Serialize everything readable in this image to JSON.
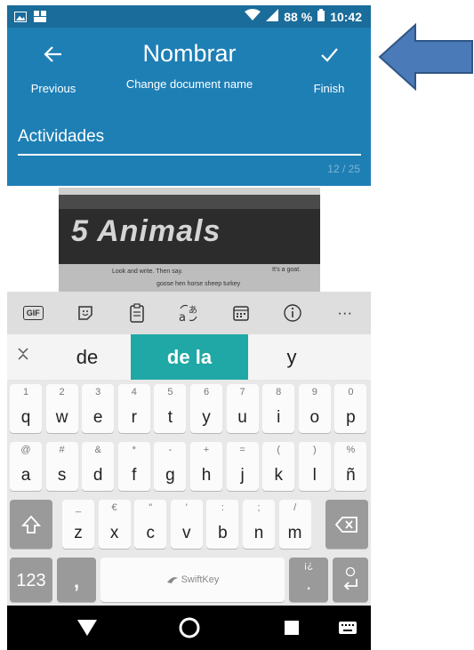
{
  "status_bar": {
    "battery": "88 %",
    "time": "10:42"
  },
  "app_bar": {
    "previous_label": "Previous",
    "title": "Nombrar",
    "subtitle": "Change document name",
    "finish_label": "Finish",
    "name_value": "Actividades",
    "char_count": "12 / 25"
  },
  "preview": {
    "heading": "5 Animals",
    "instruction": "Look and write. Then say.",
    "badge": "It's a goat.",
    "words": "goose  hen  horse  sheep  turkey"
  },
  "keyboard": {
    "toolbar": {
      "gif": "GIF",
      "more": "···"
    },
    "suggestions": [
      "de",
      "de la",
      "y"
    ],
    "row1": [
      {
        "hint": "1",
        "key": "q"
      },
      {
        "hint": "2",
        "key": "w"
      },
      {
        "hint": "3",
        "key": "e"
      },
      {
        "hint": "4",
        "key": "r"
      },
      {
        "hint": "5",
        "key": "t"
      },
      {
        "hint": "6",
        "key": "y"
      },
      {
        "hint": "7",
        "key": "u"
      },
      {
        "hint": "8",
        "key": "i"
      },
      {
        "hint": "9",
        "key": "o"
      },
      {
        "hint": "0",
        "key": "p"
      }
    ],
    "row2": [
      {
        "hint": "@",
        "key": "a"
      },
      {
        "hint": "#",
        "key": "s"
      },
      {
        "hint": "&",
        "key": "d"
      },
      {
        "hint": "*",
        "key": "f"
      },
      {
        "hint": "-",
        "key": "g"
      },
      {
        "hint": "+",
        "key": "h"
      },
      {
        "hint": "=",
        "key": "j"
      },
      {
        "hint": "(",
        "key": "k"
      },
      {
        "hint": ")",
        "key": "l"
      },
      {
        "hint": "%",
        "key": "ñ"
      }
    ],
    "row3": [
      {
        "hint": "_",
        "key": "z"
      },
      {
        "hint": "€",
        "key": "x"
      },
      {
        "hint": "\"",
        "key": "c"
      },
      {
        "hint": "'",
        "key": "v"
      },
      {
        "hint": ":",
        "key": "b"
      },
      {
        "hint": ";",
        "key": "n"
      },
      {
        "hint": "/",
        "key": "m"
      }
    ],
    "numbers_label": "123",
    "comma": ",",
    "space_label": "SwiftKey",
    "period": ".",
    "period_hint": "¡¿"
  },
  "colors": {
    "app_bar": "#1e7fb5",
    "status_bar": "#1a6c9a",
    "suggestion_highlight": "#1fa8a5",
    "arrow": "#4a7ab8"
  }
}
